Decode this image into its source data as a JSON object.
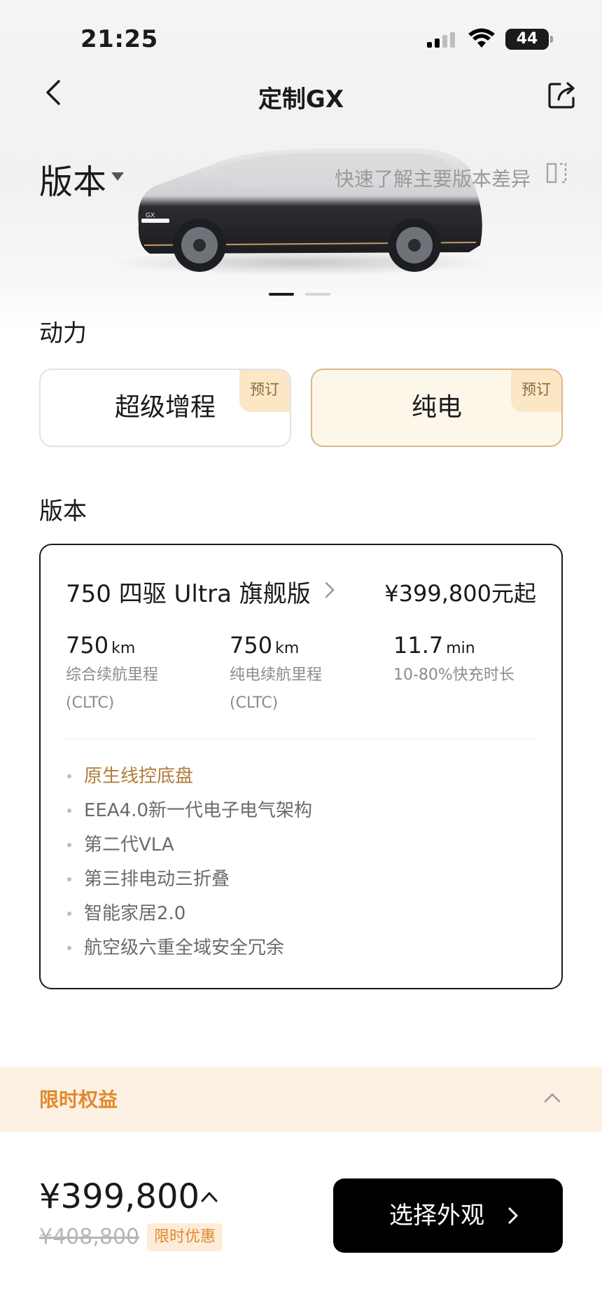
{
  "status_bar": {
    "time": "21:25",
    "battery": "44"
  },
  "nav": {
    "title": "定制GX"
  },
  "hero": {
    "version_title": "版本",
    "compare_text": "快速了解主要版本差异",
    "car_badge": "GX",
    "carousel_pages": 2,
    "carousel_active": 1
  },
  "power": {
    "label": "动力",
    "options": [
      {
        "label": "超级增程",
        "tag": "预订",
        "selected": false
      },
      {
        "label": "纯电",
        "tag": "预订",
        "selected": true
      }
    ]
  },
  "trim": {
    "section_label": "版本",
    "name": "750 四驱 Ultra 旗舰版",
    "price": "¥399,800元起",
    "specs": [
      {
        "value": "750",
        "unit": "km",
        "label_line1": "综合续航里程",
        "label_line2": "(CLTC)"
      },
      {
        "value": "750",
        "unit": "km",
        "label_line1": "纯电续航里程",
        "label_line2": "(CLTC)"
      },
      {
        "value": "11.7",
        "unit": "min",
        "label_line1": "10-80%快充时长",
        "label_line2": ""
      }
    ],
    "features": [
      {
        "text": "原生线控底盘",
        "highlight": true
      },
      {
        "text": "EEA4.0新一代电子电气架构",
        "highlight": false
      },
      {
        "text": "第二代VLA",
        "highlight": false
      },
      {
        "text": "第三排电动三折叠",
        "highlight": false
      },
      {
        "text": "智能家居2.0",
        "highlight": false
      },
      {
        "text": "航空级六重全域安全冗余",
        "highlight": false
      }
    ]
  },
  "benefits": {
    "label": "限时权益"
  },
  "bottom": {
    "price": "¥399,800",
    "original_price": "¥408,800",
    "promo_badge": "限时优惠",
    "cta_label": "选择外观"
  },
  "colors": {
    "accent_gold": "#b07c3a",
    "accent_orange": "#e0892c",
    "selected_bg": "#fdf7ea",
    "cta_bg": "#000000"
  }
}
